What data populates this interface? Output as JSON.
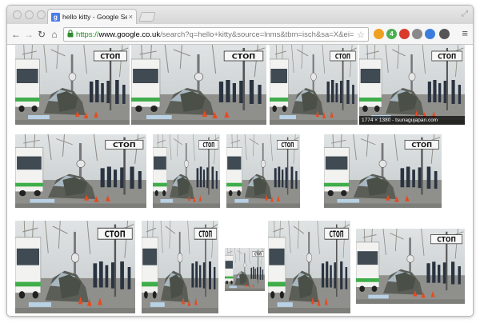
{
  "tab": {
    "title": "hello kitty - Google Search",
    "close_label": "×",
    "favicon_label": "g"
  },
  "toolbar": {
    "url_scheme": "https://",
    "url_host": "www.google.co.uk",
    "url_path": "/search?q=hello+kitty&source=lnms&tbm=isch&sa=X&ei=R...",
    "back_label": "←",
    "forward_label": "→",
    "reload_label": "↻",
    "home_label": "⌂",
    "lock_label": "🔒",
    "star_label": "☆",
    "menu_label": "≡"
  },
  "extensions": [
    {
      "icon": "orange-circle-extension-icon",
      "color": "#f0a020",
      "label": ""
    },
    {
      "icon": "green-badge-extension-icon",
      "color": "#4caf50",
      "label": "4"
    },
    {
      "icon": "red-circle-extension-icon",
      "color": "#d93a2b",
      "label": ""
    },
    {
      "icon": "gray-square-extension-icon",
      "color": "#8a8a8a",
      "label": ""
    },
    {
      "icon": "blue-download-extension-icon",
      "color": "#3b7ddd",
      "label": ""
    },
    {
      "icon": "camera-extension-icon",
      "color": "#555555",
      "label": ""
    }
  ],
  "sign_text": "СТОП",
  "results": [
    {
      "caption": ""
    },
    {
      "caption": ""
    },
    {
      "caption": ""
    },
    {
      "caption": "1774 × 1380 - tsunagujapan.com"
    },
    {
      "caption": ""
    },
    {
      "caption": ""
    },
    {
      "caption": ""
    },
    {
      "caption": ""
    },
    {
      "caption": ""
    },
    {
      "caption": ""
    },
    {
      "caption": ""
    },
    {
      "caption": ""
    },
    {
      "caption": ""
    }
  ]
}
